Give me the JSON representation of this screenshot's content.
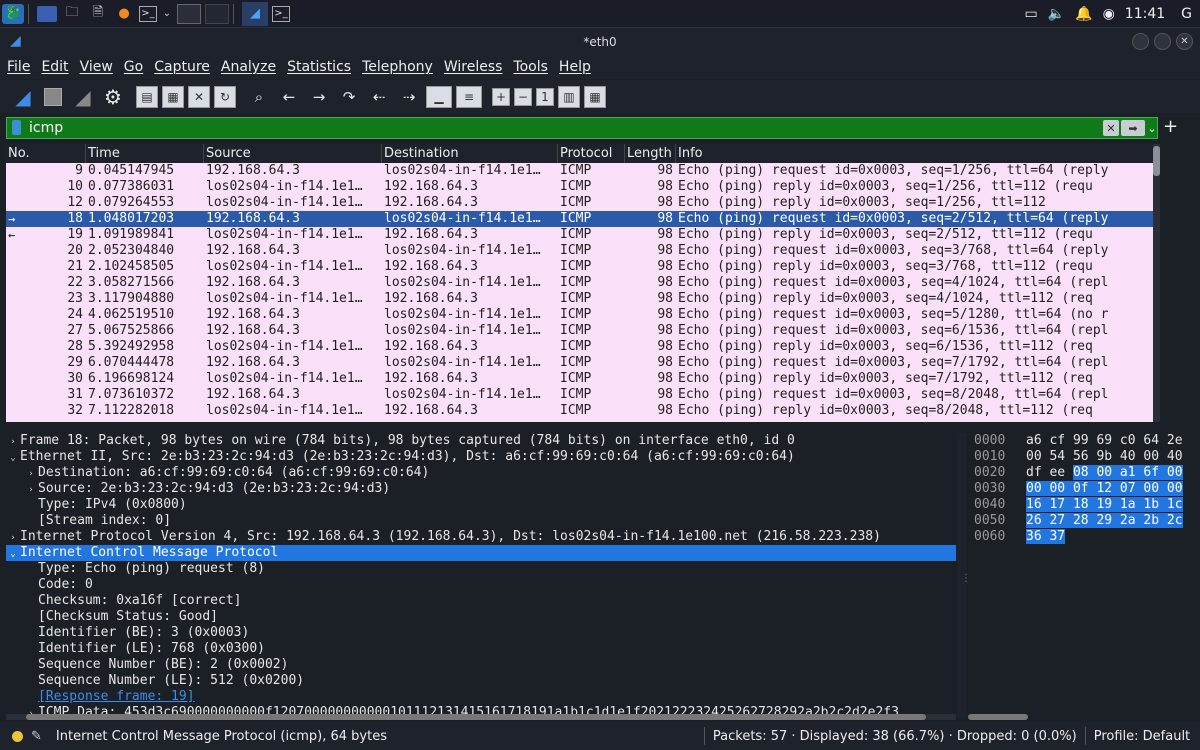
{
  "taskbar": {
    "clock": "11:41",
    "right_icon": "G"
  },
  "window": {
    "title": "*eth0"
  },
  "menu": [
    "File",
    "Edit",
    "View",
    "Go",
    "Capture",
    "Analyze",
    "Statistics",
    "Telephony",
    "Wireless",
    "Tools",
    "Help"
  ],
  "filter": {
    "value": "icmp",
    "color": "#0f7a17"
  },
  "columns": [
    "No.",
    "Time",
    "Source",
    "Destination",
    "Protocol",
    "Length",
    "Info"
  ],
  "packets": [
    {
      "no": "9",
      "time": "0.045147945",
      "src": "192.168.64.3",
      "dst": "los02s04-in-f14.1e1…",
      "proto": "ICMP",
      "len": "98",
      "info": "Echo (ping) request  id=0x0003, seq=1/256, ttl=64 (reply"
    },
    {
      "no": "10",
      "time": "0.077386031",
      "src": "los02s04-in-f14.1e1…",
      "dst": "192.168.64.3",
      "proto": "ICMP",
      "len": "98",
      "info": "Echo (ping) reply    id=0x0003, seq=1/256, ttl=112 (requ"
    },
    {
      "no": "12",
      "time": "0.079264553",
      "src": "los02s04-in-f14.1e1…",
      "dst": "192.168.64.3",
      "proto": "ICMP",
      "len": "98",
      "info": "Echo (ping) reply    id=0x0003, seq=1/256, ttl=112"
    },
    {
      "no": "18",
      "time": "1.048017203",
      "src": "192.168.64.3",
      "dst": "los02s04-in-f14.1e1…",
      "proto": "ICMP",
      "len": "98",
      "info": "Echo (ping) request  id=0x0003, seq=2/512, ttl=64 (reply",
      "selected": true,
      "mark": "→"
    },
    {
      "no": "19",
      "time": "1.091989841",
      "src": "los02s04-in-f14.1e1…",
      "dst": "192.168.64.3",
      "proto": "ICMP",
      "len": "98",
      "info": "Echo (ping) reply    id=0x0003, seq=2/512, ttl=112 (requ",
      "mark": "←"
    },
    {
      "no": "20",
      "time": "2.052304840",
      "src": "192.168.64.3",
      "dst": "los02s04-in-f14.1e1…",
      "proto": "ICMP",
      "len": "98",
      "info": "Echo (ping) request  id=0x0003, seq=3/768, ttl=64 (reply"
    },
    {
      "no": "21",
      "time": "2.102458505",
      "src": "los02s04-in-f14.1e1…",
      "dst": "192.168.64.3",
      "proto": "ICMP",
      "len": "98",
      "info": "Echo (ping) reply    id=0x0003, seq=3/768, ttl=112 (requ"
    },
    {
      "no": "22",
      "time": "3.058271566",
      "src": "192.168.64.3",
      "dst": "los02s04-in-f14.1e1…",
      "proto": "ICMP",
      "len": "98",
      "info": "Echo (ping) request  id=0x0003, seq=4/1024, ttl=64 (repl"
    },
    {
      "no": "23",
      "time": "3.117904880",
      "src": "los02s04-in-f14.1e1…",
      "dst": "192.168.64.3",
      "proto": "ICMP",
      "len": "98",
      "info": "Echo (ping) reply    id=0x0003, seq=4/1024, ttl=112 (req"
    },
    {
      "no": "24",
      "time": "4.062519510",
      "src": "192.168.64.3",
      "dst": "los02s04-in-f14.1e1…",
      "proto": "ICMP",
      "len": "98",
      "info": "Echo (ping) request  id=0x0003, seq=5/1280, ttl=64 (no r"
    },
    {
      "no": "27",
      "time": "5.067525866",
      "src": "192.168.64.3",
      "dst": "los02s04-in-f14.1e1…",
      "proto": "ICMP",
      "len": "98",
      "info": "Echo (ping) request  id=0x0003, seq=6/1536, ttl=64 (repl"
    },
    {
      "no": "28",
      "time": "5.392492958",
      "src": "los02s04-in-f14.1e1…",
      "dst": "192.168.64.3",
      "proto": "ICMP",
      "len": "98",
      "info": "Echo (ping) reply    id=0x0003, seq=6/1536, ttl=112 (req"
    },
    {
      "no": "29",
      "time": "6.070444478",
      "src": "192.168.64.3",
      "dst": "los02s04-in-f14.1e1…",
      "proto": "ICMP",
      "len": "98",
      "info": "Echo (ping) request  id=0x0003, seq=7/1792, ttl=64 (repl"
    },
    {
      "no": "30",
      "time": "6.196698124",
      "src": "los02s04-in-f14.1e1…",
      "dst": "192.168.64.3",
      "proto": "ICMP",
      "len": "98",
      "info": "Echo (ping) reply    id=0x0003, seq=7/1792, ttl=112 (req"
    },
    {
      "no": "31",
      "time": "7.073610372",
      "src": "192.168.64.3",
      "dst": "los02s04-in-f14.1e1…",
      "proto": "ICMP",
      "len": "98",
      "info": "Echo (ping) request  id=0x0003, seq=8/2048, ttl=64 (repl"
    },
    {
      "no": "32",
      "time": "7.112282018",
      "src": "los02s04-in-f14.1e1…",
      "dst": "192.168.64.3",
      "proto": "ICMP",
      "len": "98",
      "info": "Echo (ping) reply    id=0x0003, seq=8/2048, ttl=112 (req"
    }
  ],
  "details": [
    {
      "arrow": "›",
      "indent": 0,
      "text": "Frame 18: Packet, 98 bytes on wire (784 bits), 98 bytes captured (784 bits) on interface eth0, id 0"
    },
    {
      "arrow": "⌄",
      "indent": 0,
      "text": "Ethernet II, Src: 2e:b3:23:2c:94:d3 (2e:b3:23:2c:94:d3), Dst: a6:cf:99:69:c0:64 (a6:cf:99:69:c0:64)"
    },
    {
      "arrow": "›",
      "indent": 1,
      "text": "Destination: a6:cf:99:69:c0:64 (a6:cf:99:69:c0:64)"
    },
    {
      "arrow": "›",
      "indent": 1,
      "text": "Source: 2e:b3:23:2c:94:d3 (2e:b3:23:2c:94:d3)"
    },
    {
      "arrow": "",
      "indent": 1,
      "text": "Type: IPv4 (0x0800)"
    },
    {
      "arrow": "",
      "indent": 1,
      "text": "[Stream index: 0]"
    },
    {
      "arrow": "›",
      "indent": 0,
      "text": "Internet Protocol Version 4, Src: 192.168.64.3 (192.168.64.3), Dst: los02s04-in-f14.1e100.net (216.58.223.238)"
    },
    {
      "arrow": "⌄",
      "indent": 0,
      "text": "Internet Control Message Protocol",
      "selected": true
    },
    {
      "arrow": "",
      "indent": 1,
      "text": "Type: Echo (ping) request (8)"
    },
    {
      "arrow": "",
      "indent": 1,
      "text": "Code: 0"
    },
    {
      "arrow": "",
      "indent": 1,
      "text": "Checksum: 0xa16f [correct]"
    },
    {
      "arrow": "",
      "indent": 1,
      "text": "[Checksum Status: Good]"
    },
    {
      "arrow": "",
      "indent": 1,
      "text": "Identifier (BE): 3 (0x0003)"
    },
    {
      "arrow": "",
      "indent": 1,
      "text": "Identifier (LE): 768 (0x0300)"
    },
    {
      "arrow": "",
      "indent": 1,
      "text": "Sequence Number (BE): 2 (0x0002)"
    },
    {
      "arrow": "",
      "indent": 1,
      "text": "Sequence Number (LE): 512 (0x0200)"
    },
    {
      "arrow": "",
      "indent": 1,
      "text": "[Response frame: 19]",
      "link": true
    },
    {
      "arrow": "›",
      "indent": 1,
      "text": "ICMP Data: 453d3c690000000000f120700000000000101112131415161718191a1b1c1d1e1f202122232425262728292a2b2c2d2e2f3"
    }
  ],
  "hex": [
    {
      "off": "0000",
      "pre": "a6 cf 99 69 c0 64 2e",
      "hl": ""
    },
    {
      "off": "0010",
      "pre": "00 54 56 9b 40 00 40",
      "hl": ""
    },
    {
      "off": "0020",
      "pre": "df ee ",
      "hl": "08 00 a1 6f 00"
    },
    {
      "off": "0030",
      "pre": "",
      "hl": "00 00 0f 12 07 00 00"
    },
    {
      "off": "0040",
      "pre": "",
      "hl": "16 17 18 19 1a 1b 1c"
    },
    {
      "off": "0050",
      "pre": "",
      "hl": "26 27 28 29 2a 2b 2c"
    },
    {
      "off": "0060",
      "pre": "",
      "hl": "36 37"
    }
  ],
  "status": {
    "selected_field": "Internet Control Message Protocol (icmp), 64 bytes",
    "packets": "Packets: 57 · Displayed: 38 (66.7%) · Dropped: 0 (0.0%)",
    "profile": "Profile: Default"
  }
}
